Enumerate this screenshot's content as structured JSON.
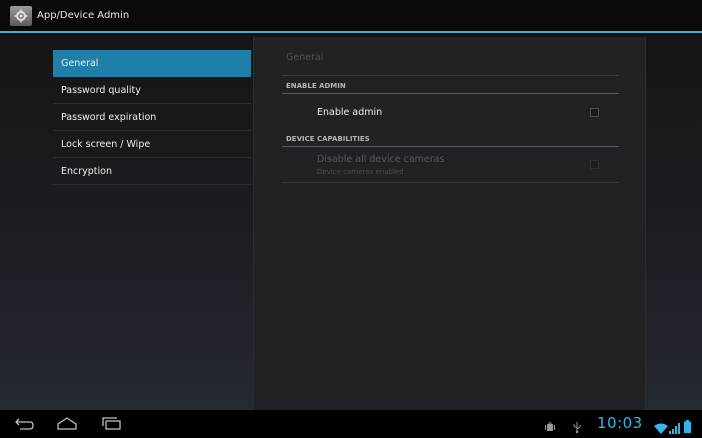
{
  "titlebar": {
    "title": "App/Device Admin",
    "icon": "settings-folder-icon"
  },
  "nav": {
    "items": [
      {
        "label": "General",
        "selected": true
      },
      {
        "label": "Password quality",
        "selected": false
      },
      {
        "label": "Password expiration",
        "selected": false
      },
      {
        "label": "Lock screen / Wipe",
        "selected": false
      },
      {
        "label": "Encryption",
        "selected": false
      }
    ]
  },
  "panel": {
    "title": "General",
    "sections": [
      {
        "header": "ENABLE ADMIN",
        "items": [
          {
            "title": "Enable admin",
            "checked": false,
            "enabled": true
          }
        ]
      },
      {
        "header": "DEVICE CAPABILITIES",
        "items": [
          {
            "title": "Disable all device cameras",
            "summary": "Device cameras enabled",
            "checked": false,
            "enabled": false
          }
        ]
      }
    ]
  },
  "system_bar": {
    "back": "back-icon",
    "home": "home-icon",
    "recents": "recent-apps-icon",
    "clock": "10:03",
    "notifications": [
      "android-debug-icon",
      "usb-icon"
    ],
    "status": [
      "wifi-icon",
      "signal-icon",
      "battery-icon"
    ]
  },
  "colors": {
    "accent": "#33b5e5",
    "selected_item": "#1f7fa8",
    "panel": "#202225"
  }
}
